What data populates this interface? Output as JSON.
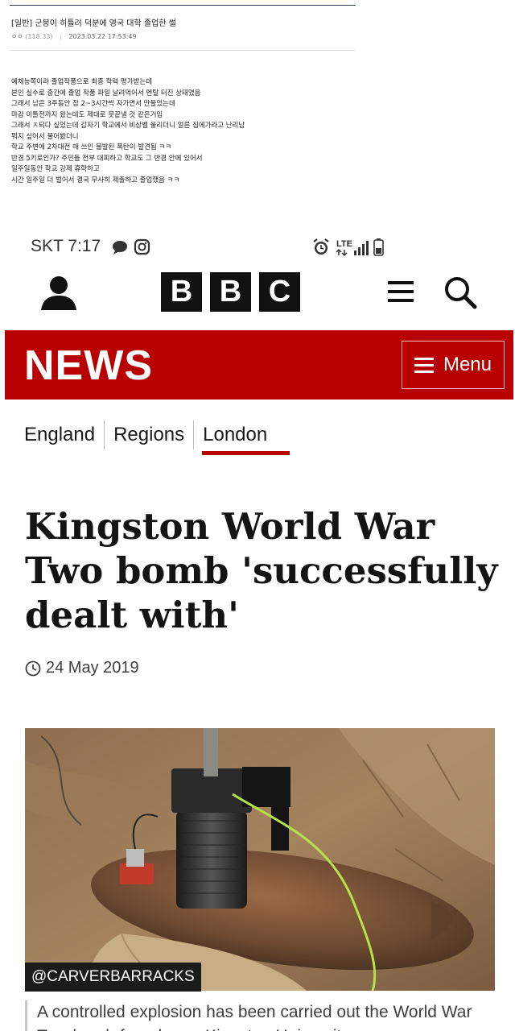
{
  "post": {
    "title": "[일반] 군붕이 히틀러 덕분에 영국 대학 졸업한 썰",
    "author": "ㅇㅇ",
    "ip": "(118.33)",
    "timestamp": "2023.03.22 17:53:49",
    "body_lines": [
      "예체능쪽이라 졸업작품으로 최종 학력 평가받는데",
      "본인 실수로 중간에 졸업 작품 파일 날려먹어서 멘탈 터진 상태였음",
      "그래서 남은 3주동안 잠 2~3시간씩 자가면서 만들었는데",
      "마감 이틀전까지 왔는데도 제대로 못끝낼 것 같은거임",
      "그래서 ㅈ되다 싶었는데 갑자기 학교에서 비상벨 울리더니 얼른 집에가라고 난리남",
      "뭐지 싶어서 물어봤더니",
      "학교 주변에 2차대전 때 쓰인 불발된 폭탄이 발견됨 ㅋㅋ",
      "반경 5키로인가? 주민들 전부 대피하고 학교도 그 반경 안에 있어서",
      "일주일동안 학교 강제 휴학하고",
      "시간 일주일 더 벌어서 결국 무사히 제출하고 졸업했음 ㅋㅋ"
    ]
  },
  "status_bar": {
    "carrier_time": "SKT 7:17",
    "network": "LTE"
  },
  "bbc": {
    "logo_letters": [
      "B",
      "B",
      "C"
    ],
    "news_label": "NEWS",
    "menu_label": "Menu",
    "nav": [
      "England",
      "Regions",
      "London"
    ],
    "active_nav": "London",
    "headline": "Kingston World War Two bomb 'successfully dealt with'",
    "date": "24 May 2019",
    "image_credit": "@CARVERBARRACKS",
    "caption": "A controlled explosion has been carried out the World War Two bomb found near Kingston University"
  },
  "colors": {
    "bbc_red": "#b80000",
    "logo_black": "#111111",
    "post_title_line": "#2d3a5a"
  },
  "icons": [
    "account-icon",
    "hamburger-icon",
    "search-icon",
    "clock-icon",
    "alarm-icon",
    "signal-icon",
    "battery-icon",
    "chat-icon",
    "instagram-icon"
  ]
}
